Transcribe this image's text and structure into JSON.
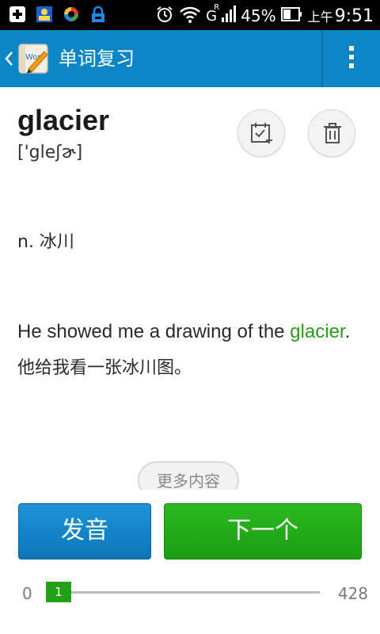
{
  "status_bar": {
    "battery": "45%",
    "ampm": "上午",
    "time": "9:51",
    "network": "G",
    "network_sup": "R"
  },
  "app_bar": {
    "title": "单词复习",
    "back_icon": "chevron-left-icon",
    "menu_icon": "overflow-menu-icon"
  },
  "card": {
    "word": "glacier",
    "phonetic": "['gleʃɚ]",
    "meaning": "n. 冰川",
    "example_prefix": "He showed me a drawing of the ",
    "example_highlight": "glacier",
    "example_suffix": ".",
    "translation": "他给我看一张冰川图。",
    "highlight_color": "#27a017"
  },
  "actions": {
    "add_icon": "calendar-check-add-icon",
    "delete_icon": "trash-icon",
    "more_label": "更多内容",
    "speak_label": "发音",
    "next_label": "下一个"
  },
  "progress": {
    "min": "0",
    "max": "428",
    "current": "1",
    "current_value": 1,
    "total": 428
  },
  "colors": {
    "appbar": "#0d86c8",
    "speak_button": "#0b7fc4",
    "next_button": "#22ab18"
  }
}
